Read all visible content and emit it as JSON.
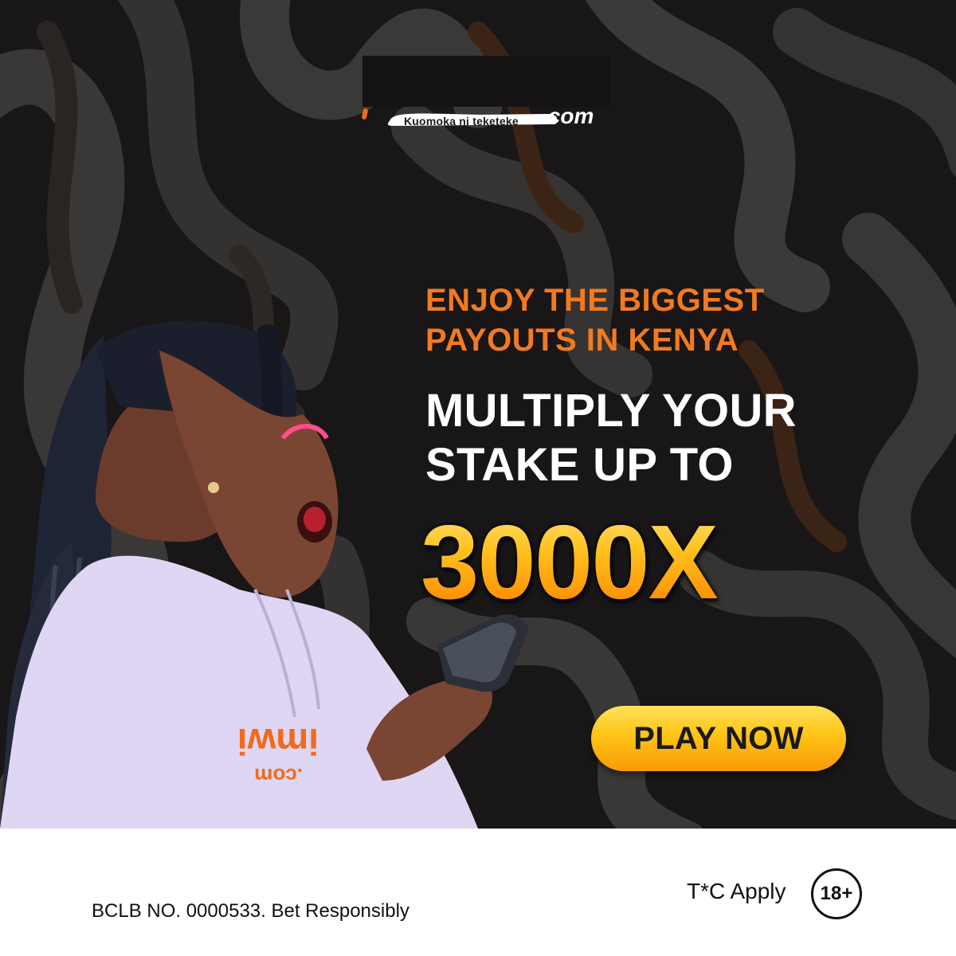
{
  "logo": {
    "tagline": "Kuomoka ni teketeke",
    "domain": ".com"
  },
  "headline": {
    "line1": "ENJOY THE BIGGEST",
    "line2": "PAYOUTS IN KENYA"
  },
  "subheadline": {
    "line1": "MULTIPLY YOUR",
    "line2": "STAKE UP TO"
  },
  "multiplier": "3000X",
  "cta": {
    "label": "PLAY NOW"
  },
  "hoodie_print": {
    "word": "imwi",
    "domain": ".com"
  },
  "footer": {
    "license": "BCLB NO. 0000533. Bet Responsibly",
    "terms": "T*C Apply",
    "age_limit": "18+"
  },
  "colors": {
    "background": "#181616",
    "orange": "#f47a1f",
    "gold": "#ffc21f",
    "white": "#ffffff"
  },
  "icons": {
    "age_badge": "age-restriction-icon"
  }
}
